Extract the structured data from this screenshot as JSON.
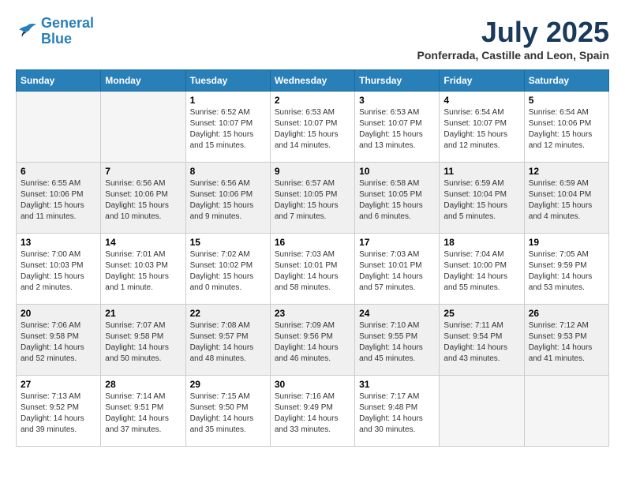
{
  "header": {
    "logo_line1": "General",
    "logo_line2": "Blue",
    "month_year": "July 2025",
    "location": "Ponferrada, Castille and Leon, Spain"
  },
  "weekdays": [
    "Sunday",
    "Monday",
    "Tuesday",
    "Wednesday",
    "Thursday",
    "Friday",
    "Saturday"
  ],
  "weeks": [
    [
      {
        "day": "",
        "info": ""
      },
      {
        "day": "",
        "info": ""
      },
      {
        "day": "1",
        "info": "Sunrise: 6:52 AM\nSunset: 10:07 PM\nDaylight: 15 hours\nand 15 minutes."
      },
      {
        "day": "2",
        "info": "Sunrise: 6:53 AM\nSunset: 10:07 PM\nDaylight: 15 hours\nand 14 minutes."
      },
      {
        "day": "3",
        "info": "Sunrise: 6:53 AM\nSunset: 10:07 PM\nDaylight: 15 hours\nand 13 minutes."
      },
      {
        "day": "4",
        "info": "Sunrise: 6:54 AM\nSunset: 10:07 PM\nDaylight: 15 hours\nand 12 minutes."
      },
      {
        "day": "5",
        "info": "Sunrise: 6:54 AM\nSunset: 10:06 PM\nDaylight: 15 hours\nand 12 minutes."
      }
    ],
    [
      {
        "day": "6",
        "info": "Sunrise: 6:55 AM\nSunset: 10:06 PM\nDaylight: 15 hours\nand 11 minutes."
      },
      {
        "day": "7",
        "info": "Sunrise: 6:56 AM\nSunset: 10:06 PM\nDaylight: 15 hours\nand 10 minutes."
      },
      {
        "day": "8",
        "info": "Sunrise: 6:56 AM\nSunset: 10:06 PM\nDaylight: 15 hours\nand 9 minutes."
      },
      {
        "day": "9",
        "info": "Sunrise: 6:57 AM\nSunset: 10:05 PM\nDaylight: 15 hours\nand 7 minutes."
      },
      {
        "day": "10",
        "info": "Sunrise: 6:58 AM\nSunset: 10:05 PM\nDaylight: 15 hours\nand 6 minutes."
      },
      {
        "day": "11",
        "info": "Sunrise: 6:59 AM\nSunset: 10:04 PM\nDaylight: 15 hours\nand 5 minutes."
      },
      {
        "day": "12",
        "info": "Sunrise: 6:59 AM\nSunset: 10:04 PM\nDaylight: 15 hours\nand 4 minutes."
      }
    ],
    [
      {
        "day": "13",
        "info": "Sunrise: 7:00 AM\nSunset: 10:03 PM\nDaylight: 15 hours\nand 2 minutes."
      },
      {
        "day": "14",
        "info": "Sunrise: 7:01 AM\nSunset: 10:03 PM\nDaylight: 15 hours\nand 1 minute."
      },
      {
        "day": "15",
        "info": "Sunrise: 7:02 AM\nSunset: 10:02 PM\nDaylight: 15 hours\nand 0 minutes."
      },
      {
        "day": "16",
        "info": "Sunrise: 7:03 AM\nSunset: 10:01 PM\nDaylight: 14 hours\nand 58 minutes."
      },
      {
        "day": "17",
        "info": "Sunrise: 7:03 AM\nSunset: 10:01 PM\nDaylight: 14 hours\nand 57 minutes."
      },
      {
        "day": "18",
        "info": "Sunrise: 7:04 AM\nSunset: 10:00 PM\nDaylight: 14 hours\nand 55 minutes."
      },
      {
        "day": "19",
        "info": "Sunrise: 7:05 AM\nSunset: 9:59 PM\nDaylight: 14 hours\nand 53 minutes."
      }
    ],
    [
      {
        "day": "20",
        "info": "Sunrise: 7:06 AM\nSunset: 9:58 PM\nDaylight: 14 hours\nand 52 minutes."
      },
      {
        "day": "21",
        "info": "Sunrise: 7:07 AM\nSunset: 9:58 PM\nDaylight: 14 hours\nand 50 minutes."
      },
      {
        "day": "22",
        "info": "Sunrise: 7:08 AM\nSunset: 9:57 PM\nDaylight: 14 hours\nand 48 minutes."
      },
      {
        "day": "23",
        "info": "Sunrise: 7:09 AM\nSunset: 9:56 PM\nDaylight: 14 hours\nand 46 minutes."
      },
      {
        "day": "24",
        "info": "Sunrise: 7:10 AM\nSunset: 9:55 PM\nDaylight: 14 hours\nand 45 minutes."
      },
      {
        "day": "25",
        "info": "Sunrise: 7:11 AM\nSunset: 9:54 PM\nDaylight: 14 hours\nand 43 minutes."
      },
      {
        "day": "26",
        "info": "Sunrise: 7:12 AM\nSunset: 9:53 PM\nDaylight: 14 hours\nand 41 minutes."
      }
    ],
    [
      {
        "day": "27",
        "info": "Sunrise: 7:13 AM\nSunset: 9:52 PM\nDaylight: 14 hours\nand 39 minutes."
      },
      {
        "day": "28",
        "info": "Sunrise: 7:14 AM\nSunset: 9:51 PM\nDaylight: 14 hours\nand 37 minutes."
      },
      {
        "day": "29",
        "info": "Sunrise: 7:15 AM\nSunset: 9:50 PM\nDaylight: 14 hours\nand 35 minutes."
      },
      {
        "day": "30",
        "info": "Sunrise: 7:16 AM\nSunset: 9:49 PM\nDaylight: 14 hours\nand 33 minutes."
      },
      {
        "day": "31",
        "info": "Sunrise: 7:17 AM\nSunset: 9:48 PM\nDaylight: 14 hours\nand 30 minutes."
      },
      {
        "day": "",
        "info": ""
      },
      {
        "day": "",
        "info": ""
      }
    ]
  ]
}
